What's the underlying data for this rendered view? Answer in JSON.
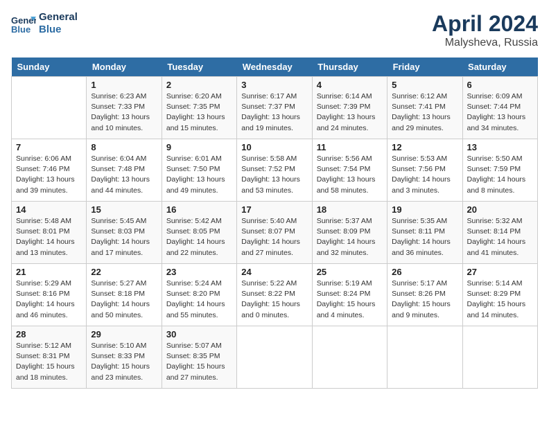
{
  "header": {
    "logo_line1": "General",
    "logo_line2": "Blue",
    "title": "April 2024",
    "location": "Malysheva, Russia"
  },
  "weekdays": [
    "Sunday",
    "Monday",
    "Tuesday",
    "Wednesday",
    "Thursday",
    "Friday",
    "Saturday"
  ],
  "weeks": [
    [
      {
        "day": "",
        "sunrise": "",
        "sunset": "",
        "daylight": ""
      },
      {
        "day": "1",
        "sunrise": "Sunrise: 6:23 AM",
        "sunset": "Sunset: 7:33 PM",
        "daylight": "Daylight: 13 hours and 10 minutes."
      },
      {
        "day": "2",
        "sunrise": "Sunrise: 6:20 AM",
        "sunset": "Sunset: 7:35 PM",
        "daylight": "Daylight: 13 hours and 15 minutes."
      },
      {
        "day": "3",
        "sunrise": "Sunrise: 6:17 AM",
        "sunset": "Sunset: 7:37 PM",
        "daylight": "Daylight: 13 hours and 19 minutes."
      },
      {
        "day": "4",
        "sunrise": "Sunrise: 6:14 AM",
        "sunset": "Sunset: 7:39 PM",
        "daylight": "Daylight: 13 hours and 24 minutes."
      },
      {
        "day": "5",
        "sunrise": "Sunrise: 6:12 AM",
        "sunset": "Sunset: 7:41 PM",
        "daylight": "Daylight: 13 hours and 29 minutes."
      },
      {
        "day": "6",
        "sunrise": "Sunrise: 6:09 AM",
        "sunset": "Sunset: 7:44 PM",
        "daylight": "Daylight: 13 hours and 34 minutes."
      }
    ],
    [
      {
        "day": "7",
        "sunrise": "Sunrise: 6:06 AM",
        "sunset": "Sunset: 7:46 PM",
        "daylight": "Daylight: 13 hours and 39 minutes."
      },
      {
        "day": "8",
        "sunrise": "Sunrise: 6:04 AM",
        "sunset": "Sunset: 7:48 PM",
        "daylight": "Daylight: 13 hours and 44 minutes."
      },
      {
        "day": "9",
        "sunrise": "Sunrise: 6:01 AM",
        "sunset": "Sunset: 7:50 PM",
        "daylight": "Daylight: 13 hours and 49 minutes."
      },
      {
        "day": "10",
        "sunrise": "Sunrise: 5:58 AM",
        "sunset": "Sunset: 7:52 PM",
        "daylight": "Daylight: 13 hours and 53 minutes."
      },
      {
        "day": "11",
        "sunrise": "Sunrise: 5:56 AM",
        "sunset": "Sunset: 7:54 PM",
        "daylight": "Daylight: 13 hours and 58 minutes."
      },
      {
        "day": "12",
        "sunrise": "Sunrise: 5:53 AM",
        "sunset": "Sunset: 7:56 PM",
        "daylight": "Daylight: 14 hours and 3 minutes."
      },
      {
        "day": "13",
        "sunrise": "Sunrise: 5:50 AM",
        "sunset": "Sunset: 7:59 PM",
        "daylight": "Daylight: 14 hours and 8 minutes."
      }
    ],
    [
      {
        "day": "14",
        "sunrise": "Sunrise: 5:48 AM",
        "sunset": "Sunset: 8:01 PM",
        "daylight": "Daylight: 14 hours and 13 minutes."
      },
      {
        "day": "15",
        "sunrise": "Sunrise: 5:45 AM",
        "sunset": "Sunset: 8:03 PM",
        "daylight": "Daylight: 14 hours and 17 minutes."
      },
      {
        "day": "16",
        "sunrise": "Sunrise: 5:42 AM",
        "sunset": "Sunset: 8:05 PM",
        "daylight": "Daylight: 14 hours and 22 minutes."
      },
      {
        "day": "17",
        "sunrise": "Sunrise: 5:40 AM",
        "sunset": "Sunset: 8:07 PM",
        "daylight": "Daylight: 14 hours and 27 minutes."
      },
      {
        "day": "18",
        "sunrise": "Sunrise: 5:37 AM",
        "sunset": "Sunset: 8:09 PM",
        "daylight": "Daylight: 14 hours and 32 minutes."
      },
      {
        "day": "19",
        "sunrise": "Sunrise: 5:35 AM",
        "sunset": "Sunset: 8:11 PM",
        "daylight": "Daylight: 14 hours and 36 minutes."
      },
      {
        "day": "20",
        "sunrise": "Sunrise: 5:32 AM",
        "sunset": "Sunset: 8:14 PM",
        "daylight": "Daylight: 14 hours and 41 minutes."
      }
    ],
    [
      {
        "day": "21",
        "sunrise": "Sunrise: 5:29 AM",
        "sunset": "Sunset: 8:16 PM",
        "daylight": "Daylight: 14 hours and 46 minutes."
      },
      {
        "day": "22",
        "sunrise": "Sunrise: 5:27 AM",
        "sunset": "Sunset: 8:18 PM",
        "daylight": "Daylight: 14 hours and 50 minutes."
      },
      {
        "day": "23",
        "sunrise": "Sunrise: 5:24 AM",
        "sunset": "Sunset: 8:20 PM",
        "daylight": "Daylight: 14 hours and 55 minutes."
      },
      {
        "day": "24",
        "sunrise": "Sunrise: 5:22 AM",
        "sunset": "Sunset: 8:22 PM",
        "daylight": "Daylight: 15 hours and 0 minutes."
      },
      {
        "day": "25",
        "sunrise": "Sunrise: 5:19 AM",
        "sunset": "Sunset: 8:24 PM",
        "daylight": "Daylight: 15 hours and 4 minutes."
      },
      {
        "day": "26",
        "sunrise": "Sunrise: 5:17 AM",
        "sunset": "Sunset: 8:26 PM",
        "daylight": "Daylight: 15 hours and 9 minutes."
      },
      {
        "day": "27",
        "sunrise": "Sunrise: 5:14 AM",
        "sunset": "Sunset: 8:29 PM",
        "daylight": "Daylight: 15 hours and 14 minutes."
      }
    ],
    [
      {
        "day": "28",
        "sunrise": "Sunrise: 5:12 AM",
        "sunset": "Sunset: 8:31 PM",
        "daylight": "Daylight: 15 hours and 18 minutes."
      },
      {
        "day": "29",
        "sunrise": "Sunrise: 5:10 AM",
        "sunset": "Sunset: 8:33 PM",
        "daylight": "Daylight: 15 hours and 23 minutes."
      },
      {
        "day": "30",
        "sunrise": "Sunrise: 5:07 AM",
        "sunset": "Sunset: 8:35 PM",
        "daylight": "Daylight: 15 hours and 27 minutes."
      },
      {
        "day": "",
        "sunrise": "",
        "sunset": "",
        "daylight": ""
      },
      {
        "day": "",
        "sunrise": "",
        "sunset": "",
        "daylight": ""
      },
      {
        "day": "",
        "sunrise": "",
        "sunset": "",
        "daylight": ""
      },
      {
        "day": "",
        "sunrise": "",
        "sunset": "",
        "daylight": ""
      }
    ]
  ]
}
